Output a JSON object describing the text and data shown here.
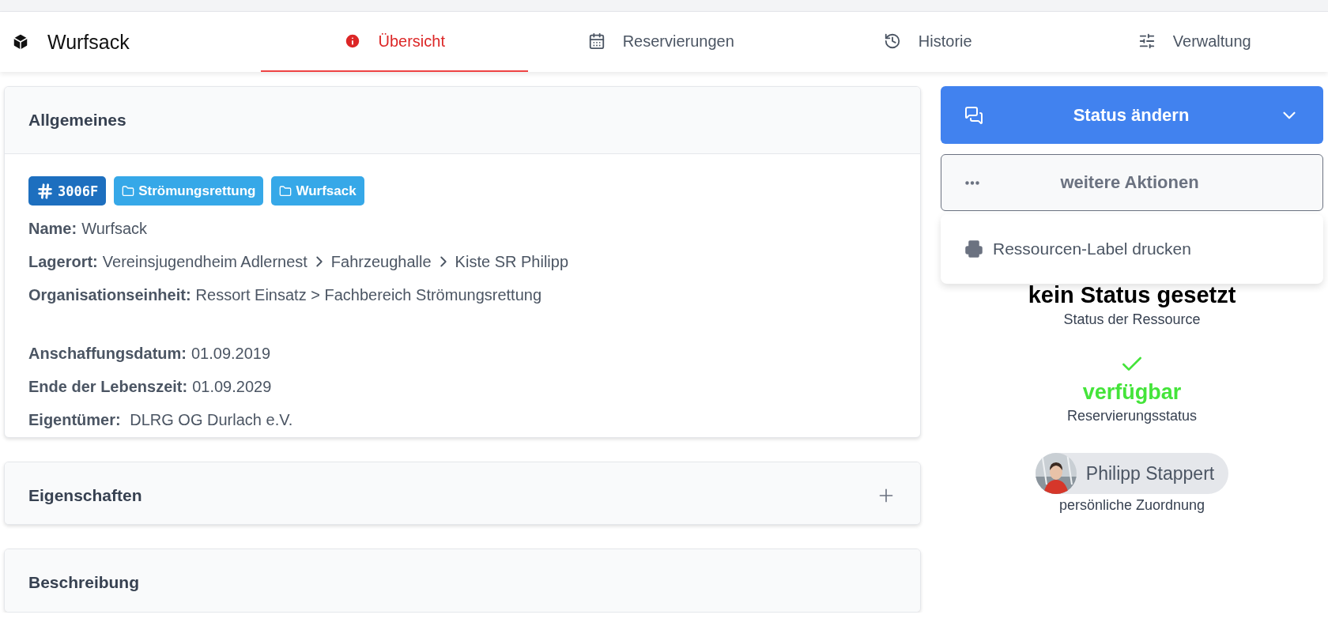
{
  "header": {
    "title": "Wurfsack"
  },
  "tabs": [
    {
      "label": "Übersicht",
      "selected": true
    },
    {
      "label": "Reservierungen",
      "selected": false
    },
    {
      "label": "Historie",
      "selected": false
    },
    {
      "label": "Verwaltung",
      "selected": false
    }
  ],
  "general": {
    "title": "Allgemeines",
    "expanded": true,
    "tags": [
      {
        "kind": "id",
        "label": "3006F"
      },
      {
        "kind": "folder",
        "label": "Strömungsrettung"
      },
      {
        "kind": "folder",
        "label": "Wurfsack"
      }
    ],
    "fields": [
      {
        "label": "Name:",
        "value": "Wurfsack"
      },
      {
        "label": "Lagerort:",
        "path": [
          "Vereinsjugendheim Adlernest",
          "Fahrzeughalle",
          "Kiste SR Philipp"
        ]
      },
      {
        "label": "Organisationseinheit:",
        "value": "Ressort Einsatz > Fachbereich Strömungsrettung"
      },
      {
        "kind": "gap"
      },
      {
        "label": "Anschaffungsdatum:",
        "value": "01.09.2019"
      },
      {
        "label": "Ende der Lebenszeit:",
        "value": "01.09.2029"
      },
      {
        "label": "Eigentümer:",
        "value": " DLRG OG Durlach e.V."
      }
    ]
  },
  "sections": [
    {
      "title": "Eigenschaften",
      "expanded": false
    },
    {
      "title": "Beschreibung",
      "expanded": true
    }
  ],
  "status_button": {
    "label": "Status ändern"
  },
  "more_button": {
    "label": "weitere Aktionen"
  },
  "more_menu": [
    {
      "label": "Ressourcen-Label drucken"
    }
  ],
  "status": {
    "value": "kein Status gesetzt",
    "caption": "Status der Ressource"
  },
  "reservation": {
    "value": "verfügbar",
    "caption": "Reservierungsstatus",
    "available": true
  },
  "assignment": {
    "name": "Philipp Stappert",
    "caption": "persönliche Zuordnung"
  }
}
